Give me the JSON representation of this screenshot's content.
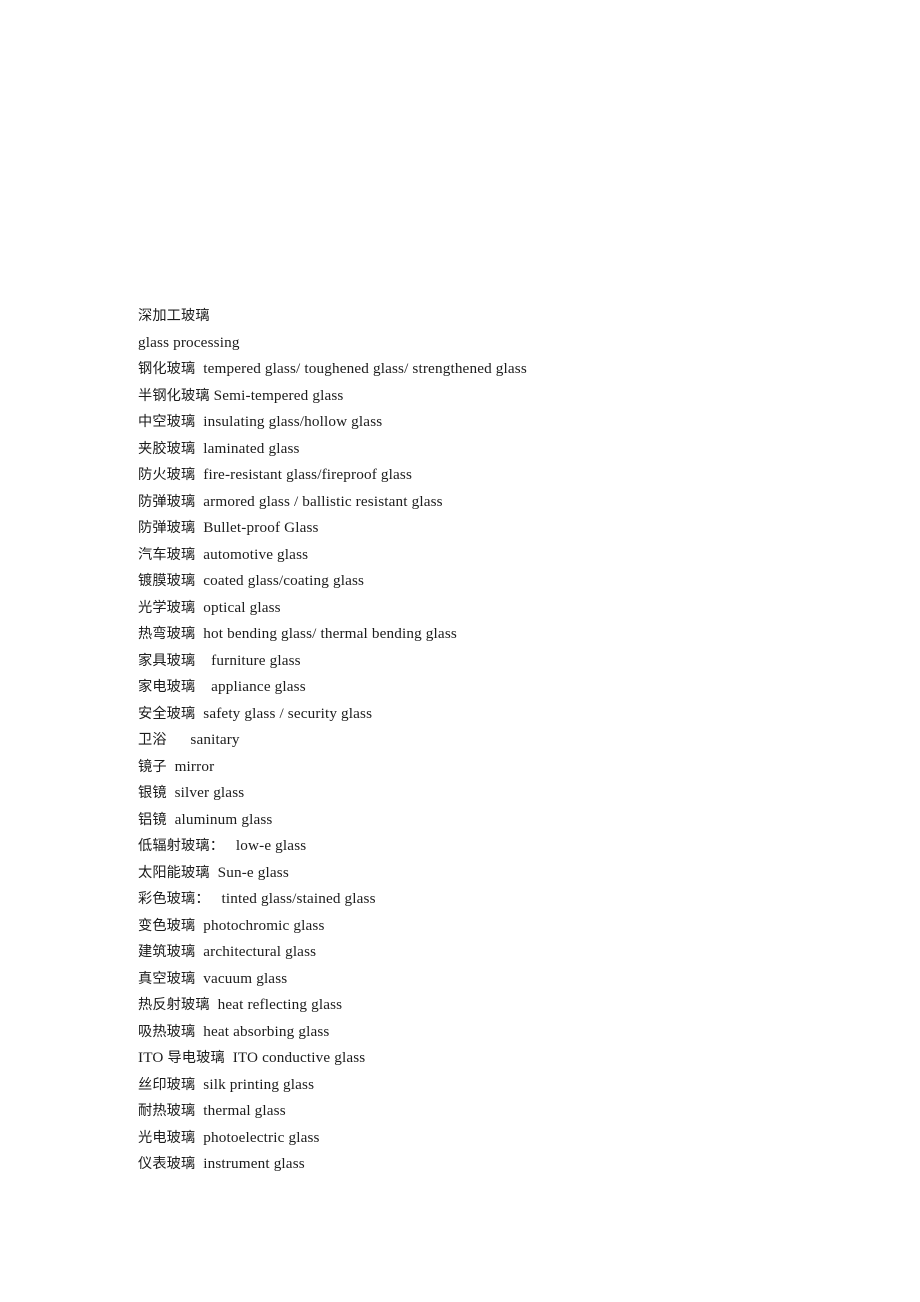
{
  "document": {
    "page_background": "#ffffff",
    "text_color": "#1c1c1c",
    "heading": "深加工玻璃",
    "heading_translation": "glass processing",
    "lines": [
      {
        "text": "深加工玻璃"
      },
      {
        "text": "glass processing"
      },
      {
        "text": "钢化玻璃  tempered glass/ toughened glass/ strengthened glass"
      },
      {
        "text": "半钢化玻璃 Semi-tempered glass"
      },
      {
        "text": "中空玻璃  insulating glass/hollow glass"
      },
      {
        "text": "夹胶玻璃  laminated glass"
      },
      {
        "text": "防火玻璃  fire-resistant glass/fireproof glass"
      },
      {
        "text": "防弹玻璃  armored glass / ballistic resistant glass"
      },
      {
        "text": "防弹玻璃  Bullet-proof Glass"
      },
      {
        "text": "汽车玻璃  automotive glass"
      },
      {
        "text": "镀膜玻璃  coated glass/coating glass"
      },
      {
        "text": "光学玻璃  optical glass"
      },
      {
        "text": "热弯玻璃  hot bending glass/ thermal bending glass"
      },
      {
        "text": "家具玻璃    furniture glass"
      },
      {
        "text": "家电玻璃    appliance glass"
      },
      {
        "text": "安全玻璃  safety glass / security glass"
      },
      {
        "text": "卫浴      sanitary"
      },
      {
        "text": "镜子  mirror"
      },
      {
        "text": "银镜  silver glass"
      },
      {
        "text": "铝镜  aluminum glass"
      },
      {
        "text": "低辐射玻璃：   low-e glass"
      },
      {
        "text": "太阳能玻璃  Sun-e glass"
      },
      {
        "text": "彩色玻璃：   tinted glass/stained glass"
      },
      {
        "text": "变色玻璃  photochromic glass"
      },
      {
        "text": "建筑玻璃  architectural glass"
      },
      {
        "text": "真空玻璃  vacuum glass"
      },
      {
        "text": "热反射玻璃  heat reflecting glass"
      },
      {
        "text": "吸热玻璃  heat absorbing glass"
      },
      {
        "text": "ITO 导电玻璃  ITO conductive glass"
      },
      {
        "text": "丝印玻璃  silk printing glass"
      },
      {
        "text": "耐热玻璃  thermal glass"
      },
      {
        "text": "光电玻璃  photoelectric glass"
      },
      {
        "text": "仪表玻璃  instrument glass"
      }
    ],
    "glossary_terms": [
      {
        "zh": "深加工玻璃",
        "en": "glass processing"
      },
      {
        "zh": "钢化玻璃",
        "en": "tempered glass/ toughened glass/ strengthened glass"
      },
      {
        "zh": "半钢化玻璃",
        "en": "Semi-tempered glass"
      },
      {
        "zh": "中空玻璃",
        "en": "insulating glass/hollow glass"
      },
      {
        "zh": "夹胶玻璃",
        "en": "laminated glass"
      },
      {
        "zh": "防火玻璃",
        "en": "fire-resistant glass/fireproof glass"
      },
      {
        "zh": "防弹玻璃",
        "en": "armored glass / ballistic resistant glass"
      },
      {
        "zh": "防弹玻璃",
        "en": "Bullet-proof Glass"
      },
      {
        "zh": "汽车玻璃",
        "en": "automotive glass"
      },
      {
        "zh": "镀膜玻璃",
        "en": "coated glass/coating glass"
      },
      {
        "zh": "光学玻璃",
        "en": "optical glass"
      },
      {
        "zh": "热弯玻璃",
        "en": "hot bending glass/ thermal bending glass"
      },
      {
        "zh": "家具玻璃",
        "en": "furniture glass"
      },
      {
        "zh": "家电玻璃",
        "en": "appliance glass"
      },
      {
        "zh": "安全玻璃",
        "en": "safety glass / security glass"
      },
      {
        "zh": "卫浴",
        "en": "sanitary"
      },
      {
        "zh": "镜子",
        "en": "mirror"
      },
      {
        "zh": "银镜",
        "en": "silver glass"
      },
      {
        "zh": "铝镜",
        "en": "aluminum glass"
      },
      {
        "zh": "低辐射玻璃：",
        "en": "low-e glass"
      },
      {
        "zh": "太阳能玻璃",
        "en": "Sun-e glass"
      },
      {
        "zh": "彩色玻璃：",
        "en": "tinted glass/stained glass"
      },
      {
        "zh": "变色玻璃",
        "en": "photochromic glass"
      },
      {
        "zh": "建筑玻璃",
        "en": "architectural glass"
      },
      {
        "zh": "真空玻璃",
        "en": "vacuum glass"
      },
      {
        "zh": "热反射玻璃",
        "en": "heat reflecting glass"
      },
      {
        "zh": "吸热玻璃",
        "en": "heat absorbing glass"
      },
      {
        "zh": "ITO 导电玻璃",
        "en": "ITO conductive glass"
      },
      {
        "zh": "丝印玻璃",
        "en": "silk printing glass"
      },
      {
        "zh": "耐热玻璃",
        "en": "thermal glass"
      },
      {
        "zh": "光电玻璃",
        "en": "photoelectric glass"
      },
      {
        "zh": "仪表玻璃",
        "en": "instrument glass"
      }
    ]
  }
}
